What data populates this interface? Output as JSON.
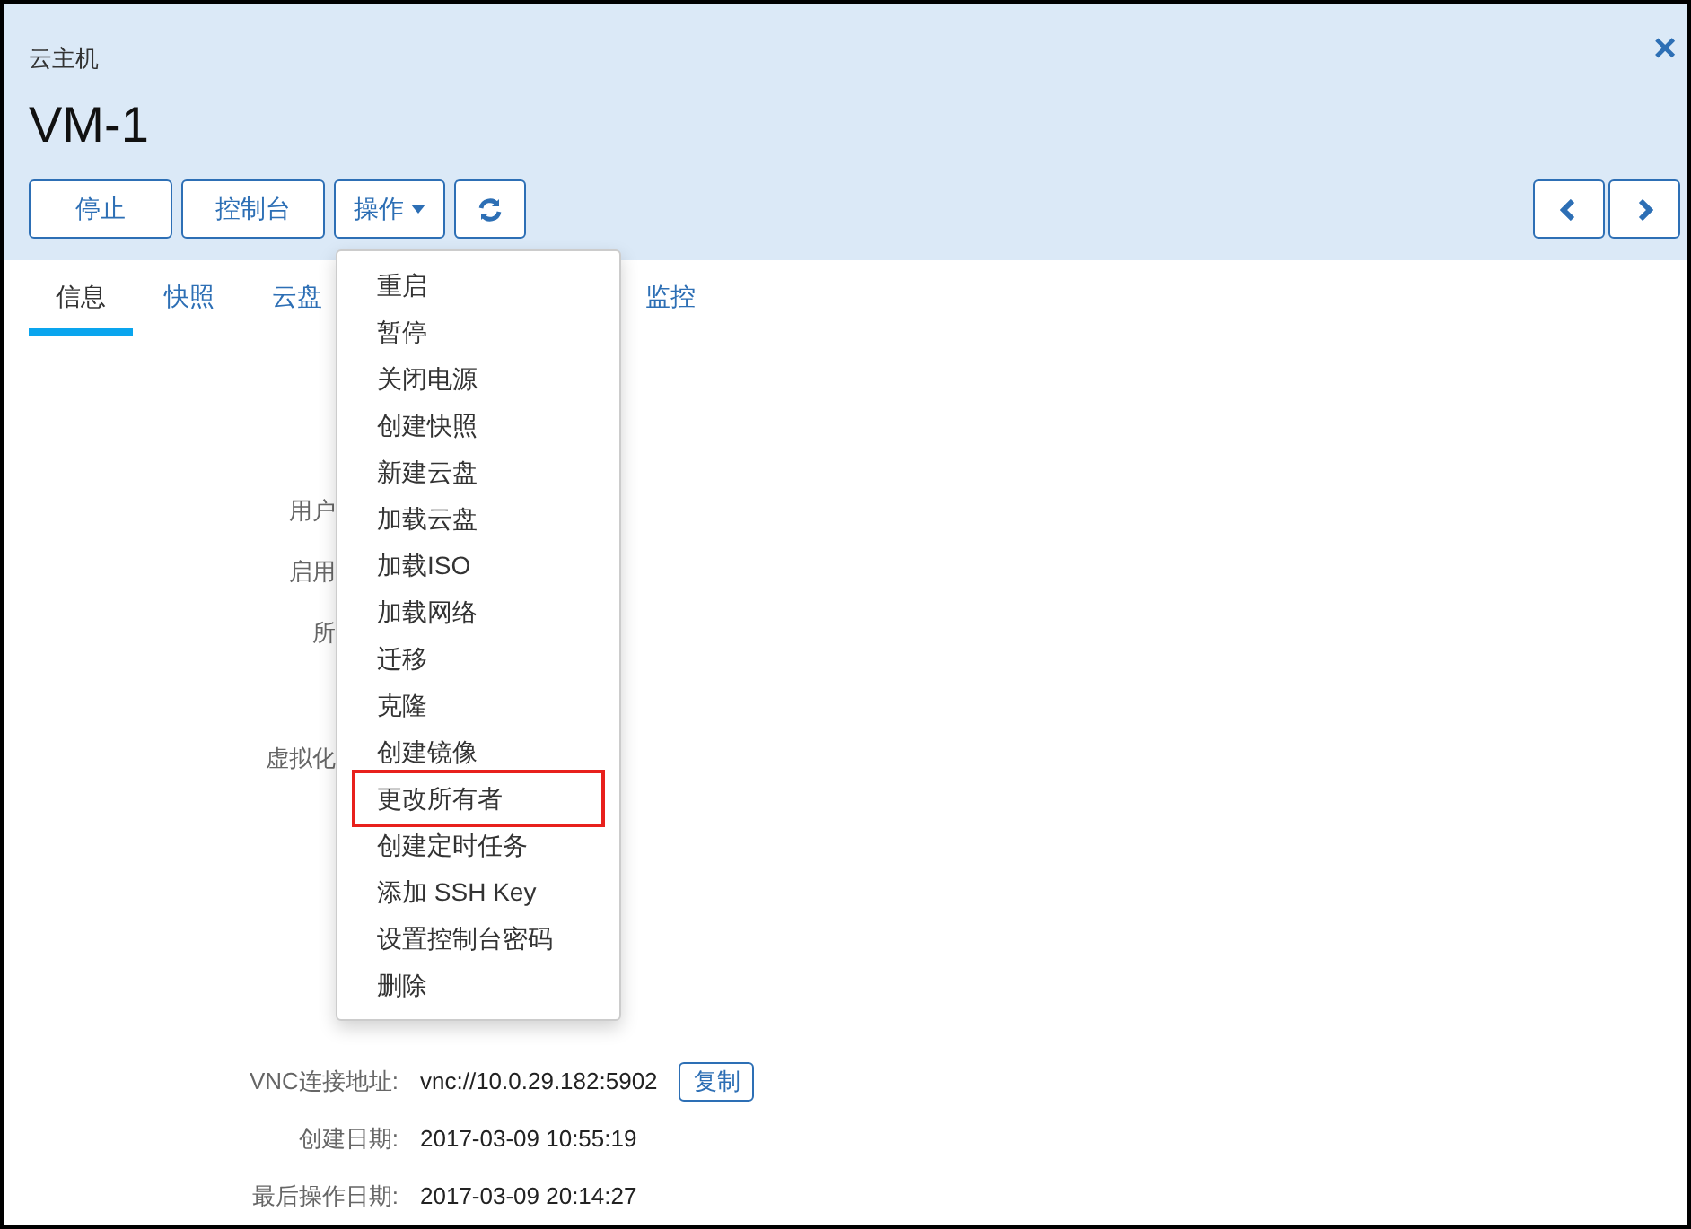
{
  "header": {
    "subtitle": "云主机",
    "title": "VM-1",
    "close": "×"
  },
  "toolbar": {
    "buttons": [
      {
        "label": "停止",
        "kind": "text"
      },
      {
        "label": "控制台",
        "kind": "text"
      },
      {
        "label": "操作",
        "kind": "dropdown"
      },
      {
        "kind": "refresh"
      }
    ],
    "nav": [
      {
        "kind": "prev"
      },
      {
        "kind": "next"
      }
    ]
  },
  "tabs": [
    {
      "label": "信息",
      "selected": true
    },
    {
      "label": "快照",
      "selected": false
    },
    {
      "label": "云盘",
      "selected": false
    },
    {
      "label": "监控",
      "selected": false
    }
  ],
  "details": [
    {
      "label": "用户"
    },
    {
      "label": "启用"
    },
    {
      "label": "所"
    },
    {
      "label": "虚拟化"
    },
    {
      "label": "VNC连接地址:",
      "value": "vnc://10.0.29.182:5902",
      "action": "复制"
    },
    {
      "label": "创建日期:",
      "value": "2017-03-09 10:55:19"
    },
    {
      "label": "最后操作日期:",
      "value": "2017-03-09 20:14:27"
    }
  ],
  "menu": {
    "items": [
      {
        "label": "重启",
        "highlighted": false
      },
      {
        "label": "暂停",
        "highlighted": false
      },
      {
        "label": "关闭电源",
        "highlighted": false
      },
      {
        "label": "创建快照",
        "highlighted": false
      },
      {
        "label": "新建云盘",
        "highlighted": false
      },
      {
        "label": "加载云盘",
        "highlighted": false
      },
      {
        "label": "加载ISO",
        "highlighted": false
      },
      {
        "label": "加载网络",
        "highlighted": false
      },
      {
        "label": "迁移",
        "highlighted": false
      },
      {
        "label": "克隆",
        "highlighted": false
      },
      {
        "label": "创建镜像",
        "highlighted": false
      },
      {
        "label": "更改所有者",
        "highlighted": true
      },
      {
        "label": "创建定时任务",
        "highlighted": false
      },
      {
        "label": "添加 SSH Key",
        "highlighted": false
      },
      {
        "label": "设置控制台密码",
        "highlighted": false
      },
      {
        "label": "删除",
        "highlighted": false
      }
    ]
  }
}
